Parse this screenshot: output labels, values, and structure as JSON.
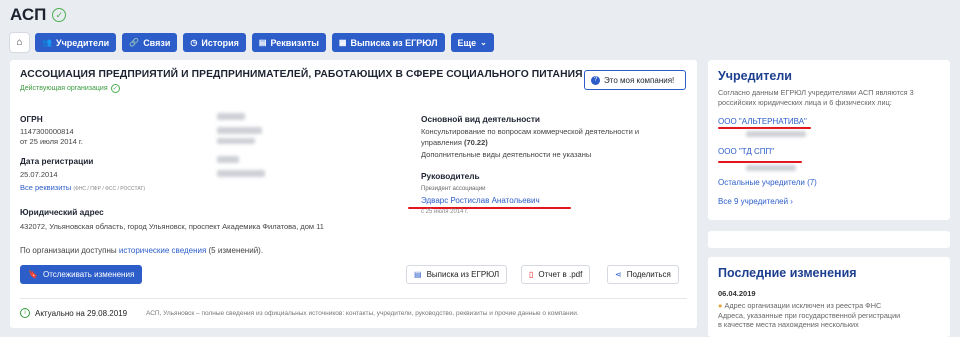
{
  "header": {
    "title": "АСП"
  },
  "nav": {
    "home_icon": "home-icon",
    "buttons": [
      {
        "label": "Учредители",
        "icon": "users-icon"
      },
      {
        "label": "Связи",
        "icon": "link-icon"
      },
      {
        "label": "История",
        "icon": "history-icon"
      },
      {
        "label": "Реквизиты",
        "icon": "document-icon"
      },
      {
        "label": "Выписка из ЕГРЮЛ",
        "icon": "list-icon"
      },
      {
        "label": "Еще",
        "icon": "chevron-down-icon"
      }
    ]
  },
  "company": {
    "name": "АССОЦИАЦИЯ ПРЕДПРИЯТИЙ И ПРЕДПРИНИМАТЕЛЕЙ, РАБОТАЮЩИХ В СФЕРЕ СОЦИАЛЬНОГО ПИТАНИЯ",
    "status": "Действующая организация",
    "my_company_label": "Это моя компания!",
    "ogrn_label": "ОГРН",
    "ogrn_value": "1147300000814",
    "ogrn_date": "от 25 июля 2014 г.",
    "reg_label": "Дата регистрации",
    "reg_value": "25.07.2014",
    "all_requisites": "Все реквизиты",
    "requisites_note": "(ФНС / ПФР / ФСС / РОССТАТ)",
    "address_label": "Юридический адрес",
    "address_value": "432072, Ульяновская область, город Ульяновск, проспект Академика Филатова, дом 11",
    "activity_label": "Основной вид деятельности",
    "activity_line1": "Консультирование по вопросам коммерческой деятельности и",
    "activity_line2_prefix": "управления ",
    "activity_code": "(70.22)",
    "activity_extra": "Дополнительные виды деятельности не указаны",
    "director_label": "Руководитель",
    "director_title": "Президент ассоциации",
    "director_name": "Эдварс Ростислав Анатольевич",
    "director_since": "с 25 июля 2014 г.",
    "history_prefix": "По организации доступны ",
    "history_link": "исторические сведения",
    "history_suffix": " (5 изменений)."
  },
  "actions": {
    "track": "Отслеживать изменения",
    "egrul": "Выписка из ЕГРЮЛ",
    "pdf": "Отчет в .pdf",
    "share": "Поделиться"
  },
  "footer": {
    "actual": "Актуально на 29.08.2019",
    "note": "АСП, Ульяновск – полные сведения из официальных источников: контакты, учредители, руководство, реквизиты и прочие данные о компании."
  },
  "founders": {
    "title": "Учредители",
    "desc": "Согласно данным ЕГРЮЛ учредителями АСП являются 3 российских юридических лица и 6 физических лиц:",
    "items": [
      "ООО \"АЛЬТЕРНАТИВА\"",
      "ООО \"ТД СПП\""
    ],
    "others": "Остальные учредители (7)",
    "all": "Все 9 учредителей"
  },
  "changes": {
    "title": "Последние изменения",
    "date": "06.04.2019",
    "text1": "Адрес организации исключен из реестра ФНС",
    "text2": "Адреса, указанные при государственной регистрации",
    "text3": "в качестве места нахождения нескольких"
  },
  "colors": {
    "accent": "#2c5dc9",
    "highlight": "#e3141b",
    "ok": "#3a9b3f",
    "bg": "#e9ecf1"
  }
}
